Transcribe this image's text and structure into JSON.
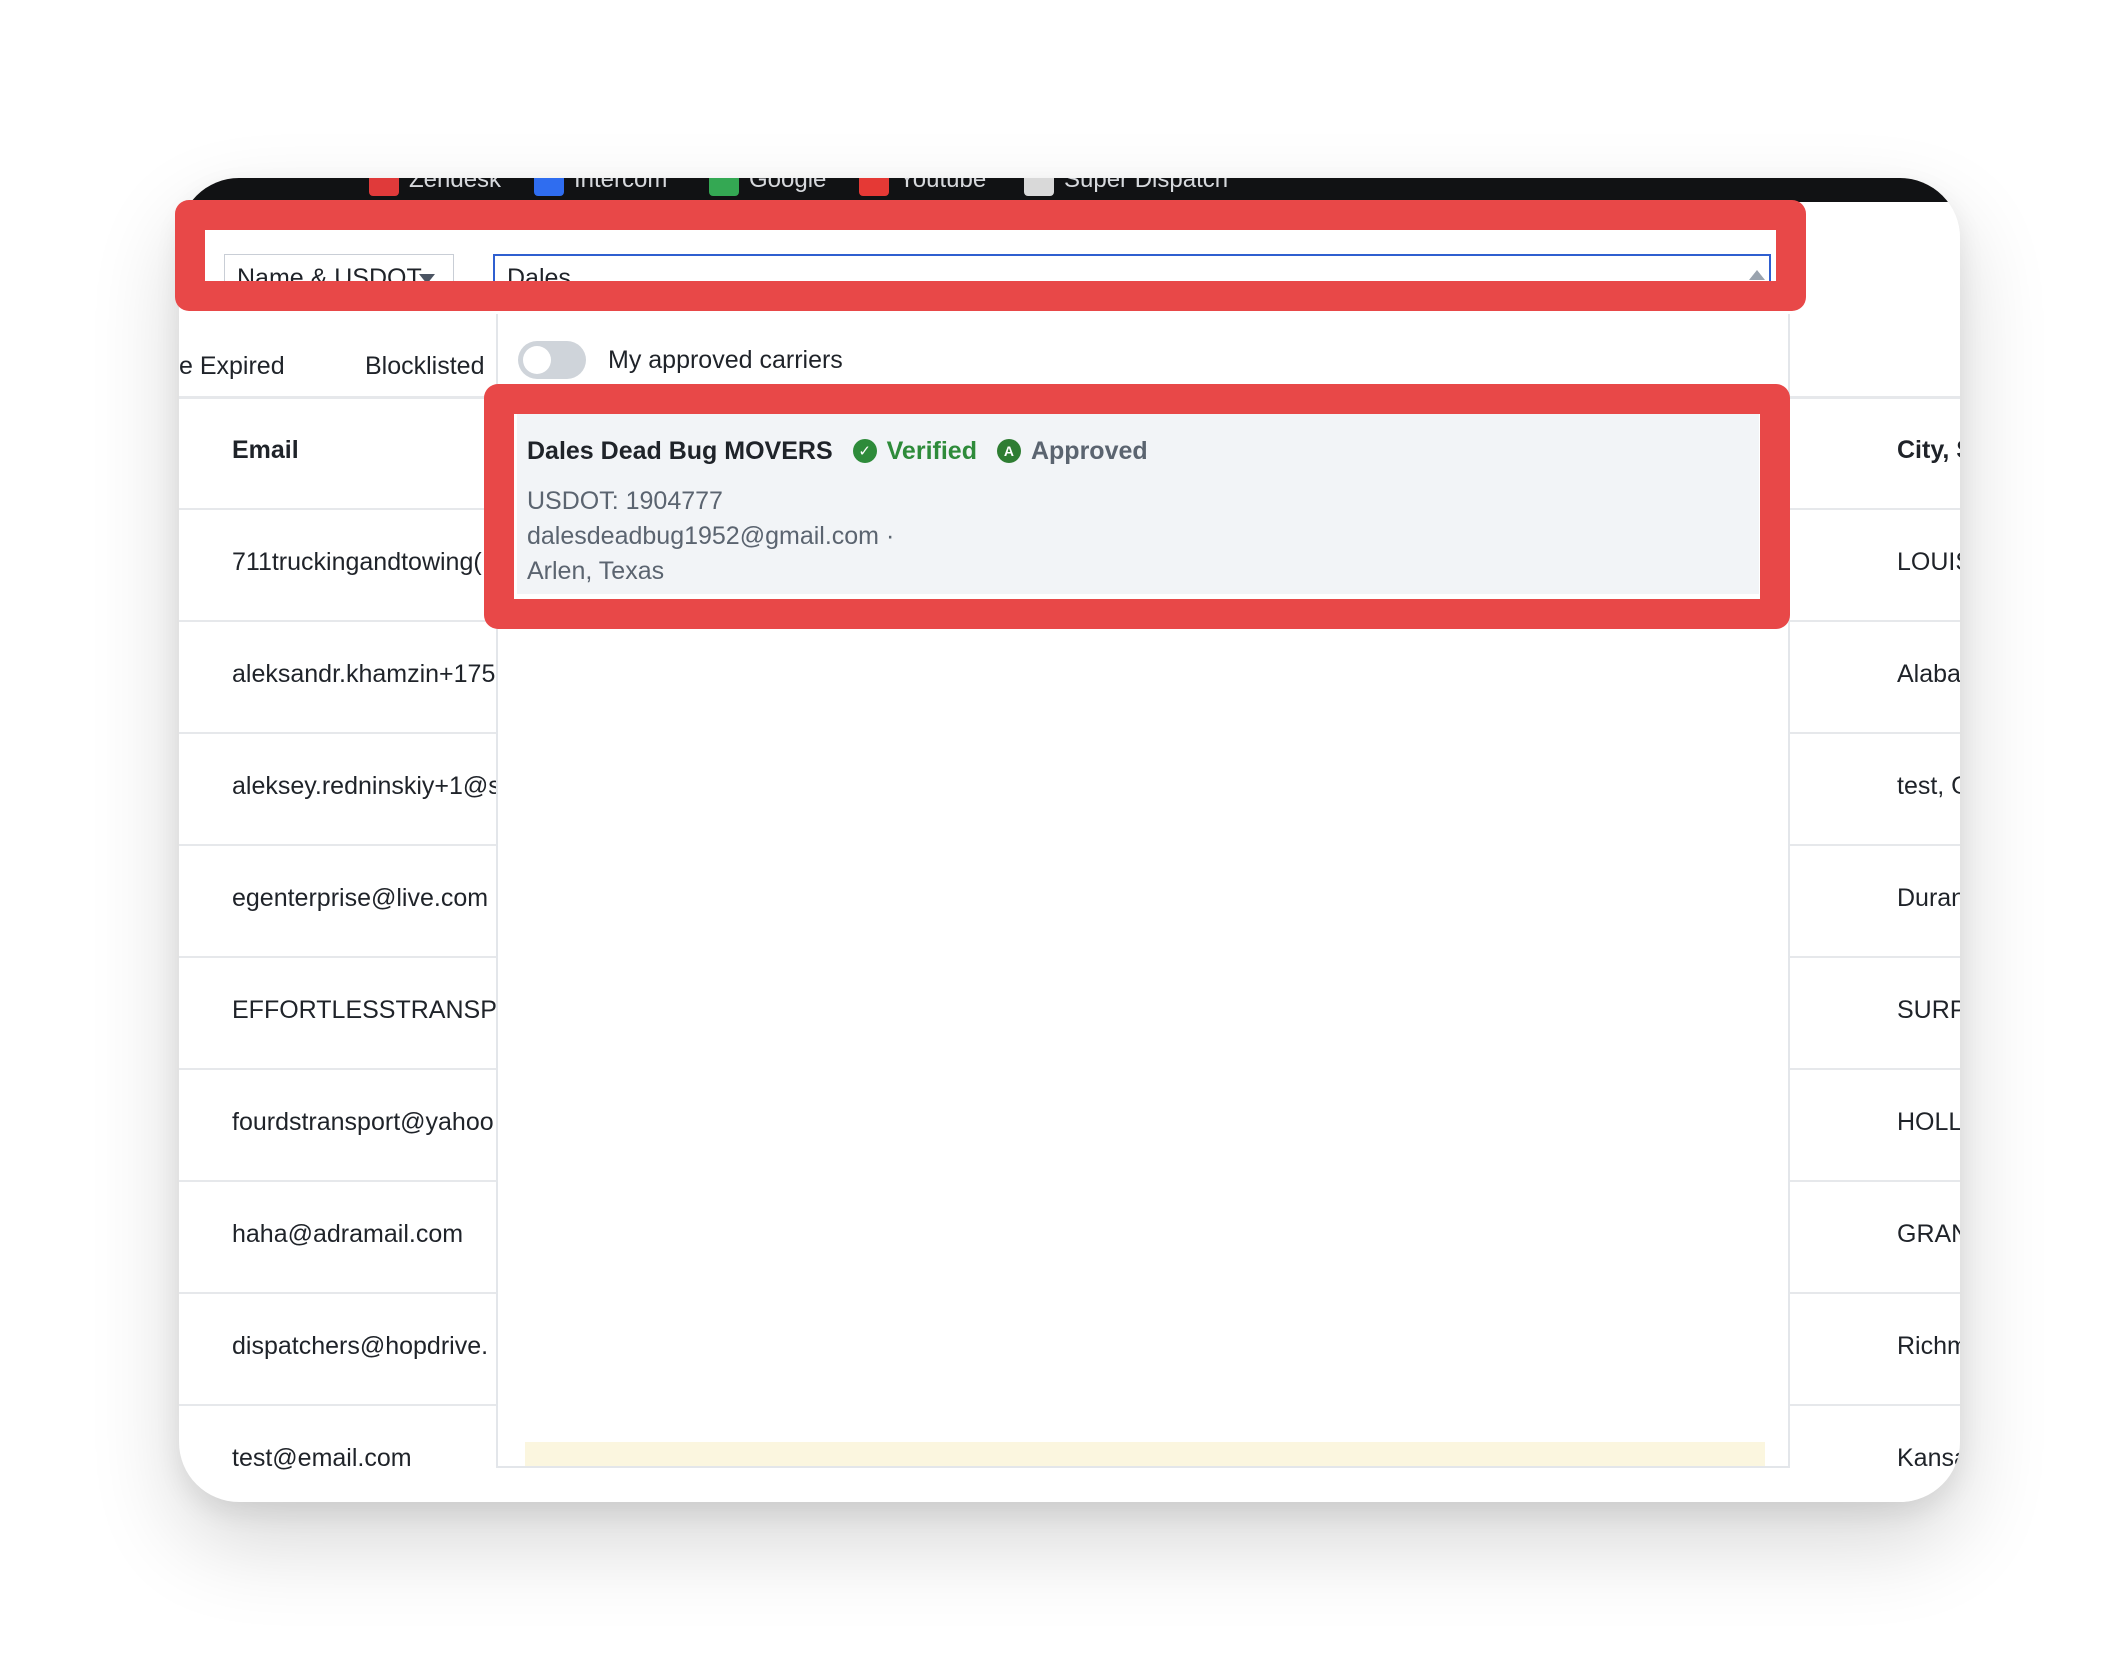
{
  "bookmarks": [
    {
      "label": "Zendesk",
      "icon": "zendesk-icon",
      "color": "#e03a3a"
    },
    {
      "label": "Intercom",
      "icon": "intercom-icon",
      "color": "#2f6df0"
    },
    {
      "label": "Google",
      "icon": "google-icon",
      "color": "#34a853"
    },
    {
      "label": "Youtube",
      "icon": "youtube-icon",
      "color": "#e53935"
    },
    {
      "label": "Super Dispatch",
      "icon": "super-dispatch-icon",
      "color": "#d9d9d9"
    }
  ],
  "search": {
    "mode_label": "Name & USDOT",
    "value": "Dales"
  },
  "filters": {
    "expired_label": "e Expired",
    "blocklisted_label": "Blocklisted"
  },
  "table": {
    "headers": {
      "email": "Email",
      "city": "City, S"
    },
    "rows": [
      {
        "email": "711truckingandtowing(",
        "city": "LOUIS"
      },
      {
        "email": "aleksandr.khamzin+175",
        "city": "Alaba"
      },
      {
        "email": "aleksey.redninskiy+1@s",
        "city": "test, G"
      },
      {
        "email": "egenterprise@live.com",
        "city": "Duran"
      },
      {
        "email": "EFFORTLESSTRANSPO",
        "city": "SURPI"
      },
      {
        "email": "fourdstransport@yahoo",
        "city": "HOLLY"
      },
      {
        "email": "haha@adramail.com",
        "city": "GRAN"
      },
      {
        "email": "dispatchers@hopdrive.",
        "city": "Richm"
      },
      {
        "email": "test@email.com",
        "city": "Kansa"
      }
    ]
  },
  "dropdown": {
    "toggle_label": "My approved carriers",
    "toggle_on": false,
    "result": {
      "name": "Dales Dead Bug MOVERS",
      "verified_label": "Verified",
      "approved_label": "Approved",
      "approved_icon_letter": "A",
      "usdot": "USDOT: 1904777",
      "email": "dalesdeadbug1952@gmail.com ·",
      "location": "Arlen, Texas"
    }
  },
  "colors": {
    "highlight": "#e84848",
    "input_focus": "#2f5fd0",
    "verified": "#2e8b3a",
    "approved": "#2e7d32"
  }
}
